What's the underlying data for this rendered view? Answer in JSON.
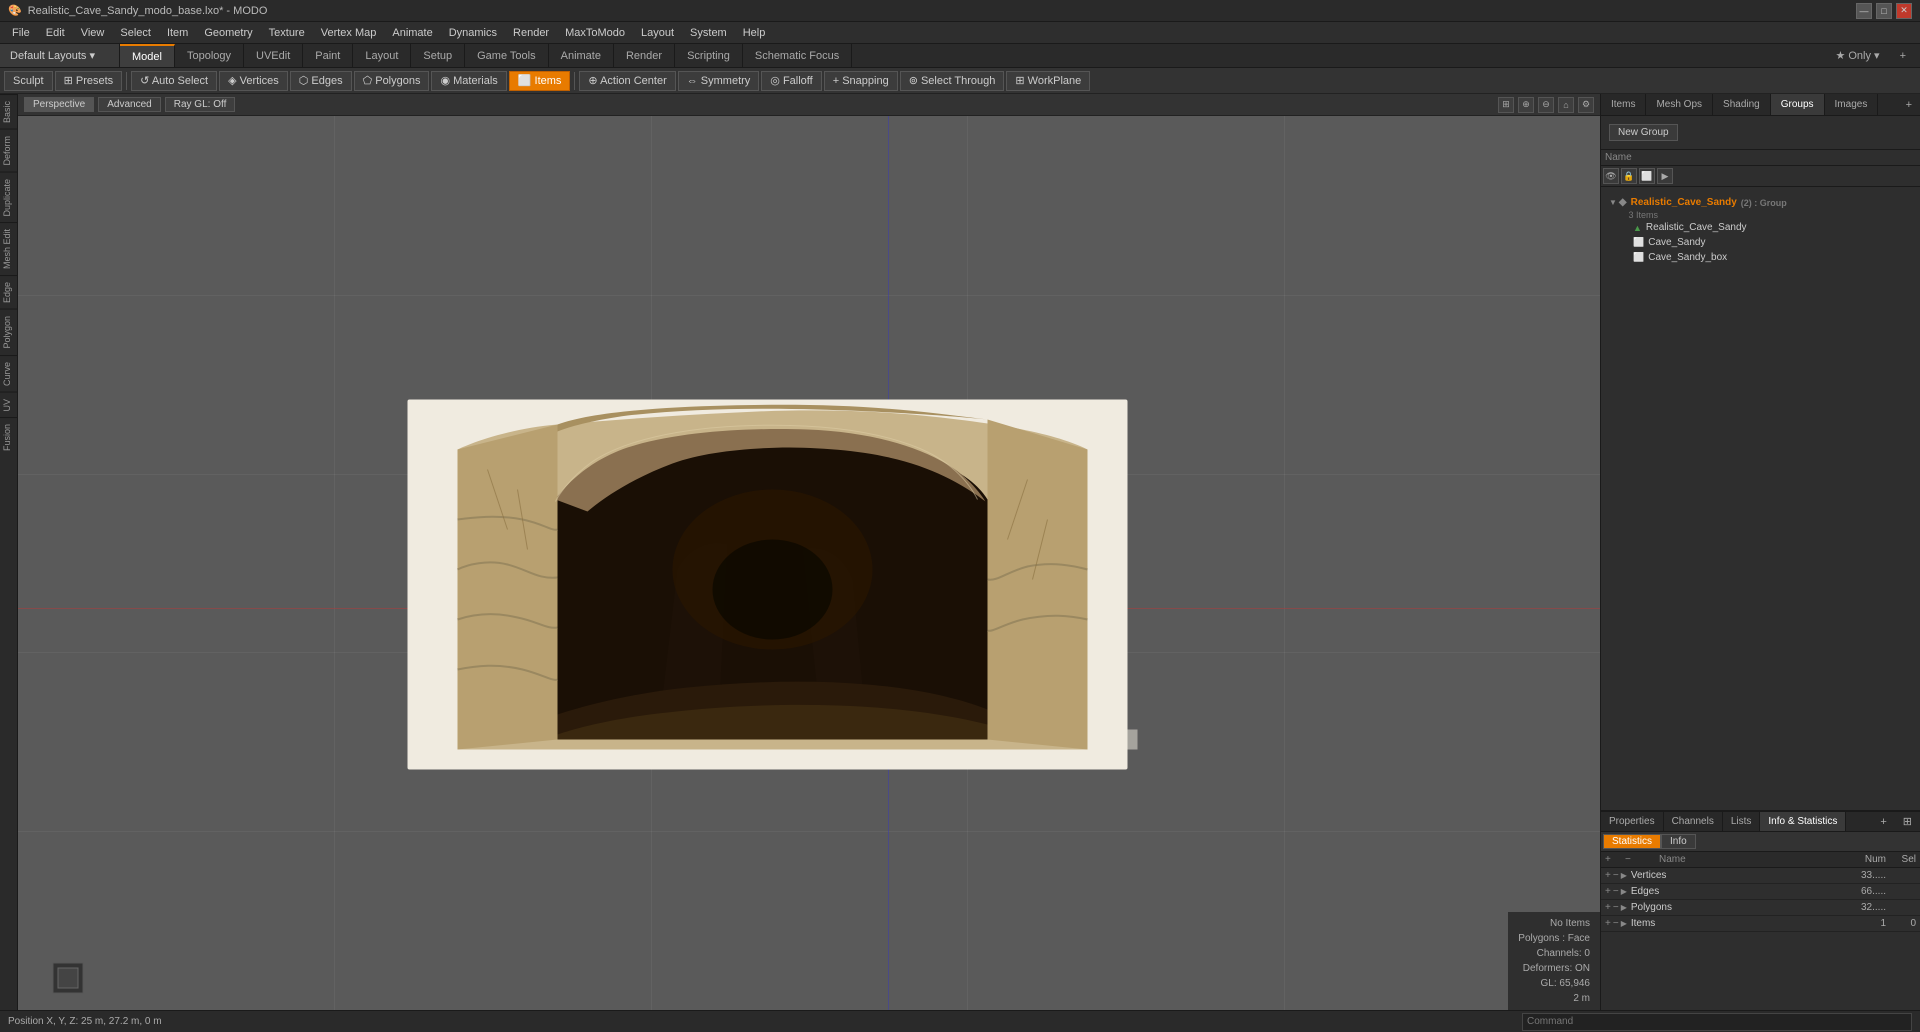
{
  "app": {
    "title": "Realistic_Cave_Sandy_modo_base.lxo* - MODO",
    "icon": "🖥"
  },
  "titlebar": {
    "title": "Realistic_Cave_Sandy_modo_base.lxo* - MODO",
    "minimize": "—",
    "maximize": "□",
    "close": "✕"
  },
  "menubar": {
    "items": [
      "File",
      "Edit",
      "View",
      "Select",
      "Item",
      "Geometry",
      "Texture",
      "Vertex Map",
      "Animate",
      "Dynamics",
      "Render",
      "MaxToModo",
      "Layout",
      "System",
      "Help"
    ]
  },
  "layout": {
    "label": "Default Layouts ▾"
  },
  "modetabs": {
    "tabs": [
      "Model",
      "Topology",
      "UVEdit",
      "Paint",
      "Layout",
      "Setup",
      "Game Tools",
      "Animate",
      "Render",
      "Scripting",
      "Schematic Focus"
    ],
    "active": "Model",
    "right": [
      "★  Only ▾",
      "+"
    ]
  },
  "toolbar": {
    "sculpt": "Sculpt",
    "presets": "⊞ Presets",
    "presets_btn": "▾",
    "auto_select": "↺ Auto Select",
    "vertices": "◈ Vertices",
    "edges": "⬡ Edges",
    "polygons": "⬠ Polygons",
    "materials": "◉ Materials",
    "items": "⬜ Items",
    "action_center": "⊕ Action Center",
    "symmetry": "⇔ Symmetry",
    "falloff": "◎ Falloff",
    "snapping": "+ Snapping",
    "select_through": "⊚ Select Through",
    "workplane": "⊞ WorkPlane"
  },
  "viewport": {
    "perspective": "Perspective",
    "advanced": "Advanced",
    "raygl": "Ray GL: Off"
  },
  "left_tabs": [
    "Basic",
    "Deform",
    "Duplicate",
    "Mesh Edit",
    "Edge",
    "Polygon",
    "Curve",
    "UV",
    "Fusion"
  ],
  "scene_tree": {
    "new_group_btn": "New Group",
    "columns": [
      "Name"
    ],
    "tabs": [
      "Items",
      "Mesh Ops",
      "Shading",
      "Groups",
      "Images"
    ],
    "active_tab": "Groups",
    "icons_row": [
      "eye",
      "lock",
      "mesh",
      "expand"
    ],
    "items": [
      {
        "id": "group1",
        "name": "Realistic_Cave_Sandy",
        "suffix": "(2) : Group",
        "sub": "3 Items",
        "type": "group",
        "level": 0,
        "expanded": true
      },
      {
        "id": "item1",
        "name": "Realistic_Cave_Sandy",
        "type": "mesh",
        "level": 1
      },
      {
        "id": "item2",
        "name": "Cave_Sandy",
        "type": "mesh",
        "level": 1
      },
      {
        "id": "item3",
        "name": "Cave_Sandy_box",
        "type": "mesh",
        "level": 1
      }
    ]
  },
  "stats_panel": {
    "tabs": [
      "Properties",
      "Channels",
      "Lists",
      "Info & Statistics"
    ],
    "active_tab": "Info & Statistics",
    "toggle_statistics": "Statistics",
    "toggle_info": "Info",
    "active_toggle": "Statistics",
    "columns": [
      {
        "label": "Name"
      },
      {
        "label": "Num"
      },
      {
        "label": "Sel"
      }
    ],
    "rows": [
      {
        "name": "Vertices",
        "num": "33.....",
        "sel": ""
      },
      {
        "name": "Edges",
        "num": "66.....",
        "sel": ""
      },
      {
        "name": "Polygons",
        "num": "32.....",
        "sel": ""
      },
      {
        "name": "Items",
        "num": "1",
        "sel": "0"
      }
    ]
  },
  "viewport_status": {
    "no_items": "No Items",
    "polygons": "Polygons : Face",
    "channels": "Channels: 0",
    "deformers": "Deformers: ON",
    "gl": "GL: 65,946",
    "scale": "2 m"
  },
  "bottombar": {
    "position": "Position X, Y, Z:  25 m, 27.2 m, 0 m",
    "command_placeholder": "Command"
  }
}
